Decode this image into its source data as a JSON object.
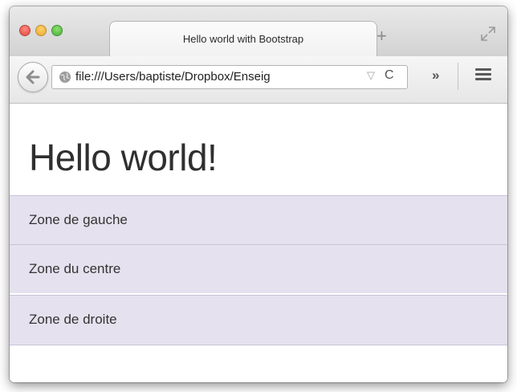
{
  "browser": {
    "tab_title": "Hello world with Bootstrap",
    "new_tab_label": "+",
    "url": "file:///Users/baptiste/Dropbox/Enseig",
    "reload_glyph": "C",
    "overflow_glyph": "»",
    "icons": {
      "back": "back-arrow-icon",
      "site": "globe-icon",
      "menu": "hamburger-menu-icon",
      "fullscreen": "fullscreen-icon"
    }
  },
  "page": {
    "heading": "Hello world!",
    "zones": [
      {
        "label": "Zone de gauche"
      },
      {
        "label": "Zone du centre"
      },
      {
        "label": "Zone de droite"
      }
    ],
    "zone_color": "#e5e1ee"
  }
}
